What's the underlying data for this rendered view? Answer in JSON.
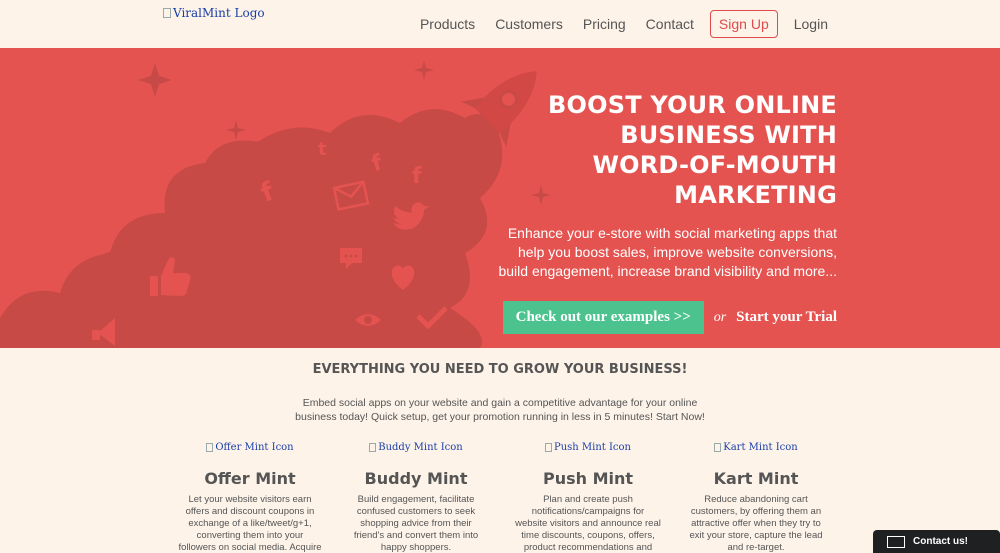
{
  "header": {
    "logo_alt": "ViralMint Logo",
    "nav": [
      "Products",
      "Customers",
      "Pricing",
      "Contact"
    ],
    "signup": "Sign Up",
    "login": "Login"
  },
  "hero": {
    "headline_lines": [
      "BOOST YOUR ONLINE",
      "BUSINESS WITH",
      "WORD-OF-MOUTH",
      "MARKETING"
    ],
    "subtext_lines": [
      "Enhance your e-store with social marketing apps that",
      "help you boost sales, improve website conversions,",
      "build engagement, increase brand visibility and more..."
    ],
    "cta_button": "Check out our examples >>",
    "or": "or",
    "trial_link": "Start your Trial"
  },
  "features": {
    "title": "EVERYTHING YOU NEED TO GROW YOUR BUSINESS!",
    "desc_lines": [
      "Embed social apps on your website and gain a competitive advantage for your online",
      "business today! Quick setup, get your promotion running in less in 5 minutes! Start Now!"
    ],
    "cards": [
      {
        "icon_alt": "Offer Mint Icon",
        "title": "Offer Mint",
        "text_lines": [
          "Let your website visitors earn",
          "offers and discount coupons in",
          "exchange of a like/tweet/g+1,",
          "converting them into your",
          "followers on social media. Acquire"
        ]
      },
      {
        "icon_alt": "Buddy Mint Icon",
        "title": "Buddy Mint",
        "text_lines": [
          "Build engagement, facilitate",
          "confused customers to seek",
          "shopping advice from their",
          "friend's and convert them into",
          "happy shoppers."
        ]
      },
      {
        "icon_alt": "Push Mint Icon",
        "title": "Push Mint",
        "text_lines": [
          "Plan and create push",
          "notifications/campaigns for",
          "website visitors and announce real",
          "time discounts, coupons, offers,",
          "product recommendations and"
        ]
      },
      {
        "icon_alt": "Kart Mint Icon",
        "title": "Kart Mint",
        "text_lines": [
          "Reduce abandoning cart",
          "customers, by offering them an",
          "attractive offer when they try to",
          "exit your store, capture the lead",
          "and re-target."
        ]
      }
    ]
  },
  "contact_widget": {
    "label": "Contact us!",
    "icon": "envelope-icon"
  },
  "colors": {
    "hero_bg": "#e55350",
    "cloud": "#c74a47",
    "cta_green": "#4cc38f",
    "page_bg": "#fdf3e9",
    "signup_red": "#e04b4b"
  }
}
